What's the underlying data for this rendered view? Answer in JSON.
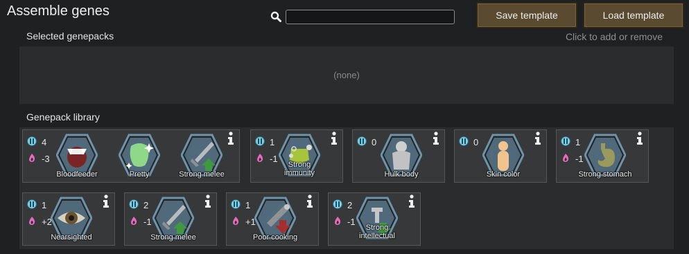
{
  "header": {
    "title": "Assemble genes",
    "search": {
      "value": "",
      "placeholder": ""
    },
    "save_label": "Save template",
    "load_label": "Load template"
  },
  "selected": {
    "label": "Selected genepacks",
    "hint": "Click to add or remove",
    "empty_text": "(none)"
  },
  "library": {
    "label": "Genepack library",
    "packs": [
      {
        "complexity": "4",
        "metabolism": "-3",
        "genes": [
          {
            "name": "Bloodfeeder",
            "icon": "fangs-icon"
          },
          {
            "name": "Pretty",
            "icon": "sparkle-face-icon"
          },
          {
            "name": "Strong melee",
            "icon": "sword-up-icon"
          }
        ]
      },
      {
        "complexity": "1",
        "metabolism": "-1",
        "genes": [
          {
            "name": "Strong immunity",
            "icon": "immunity-icon"
          }
        ]
      },
      {
        "complexity": "0",
        "metabolism": "",
        "genes": [
          {
            "name": "Hulk body",
            "icon": "body-icon"
          }
        ]
      },
      {
        "complexity": "0",
        "metabolism": "",
        "genes": [
          {
            "name": "Skin color",
            "icon": "skin-icon"
          }
        ]
      },
      {
        "complexity": "1",
        "metabolism": "-1",
        "genes": [
          {
            "name": "Strong stomach",
            "icon": "stomach-icon"
          }
        ]
      },
      {
        "complexity": "1",
        "metabolism": "+2",
        "genes": [
          {
            "name": "Nearsighted",
            "icon": "eye-icon"
          }
        ]
      },
      {
        "complexity": "2",
        "metabolism": "-1",
        "genes": [
          {
            "name": "Strong melee",
            "icon": "sword-up-icon"
          }
        ]
      },
      {
        "complexity": "1",
        "metabolism": "+1",
        "genes": [
          {
            "name": "Poor cooking",
            "icon": "cooking-down-icon"
          }
        ]
      },
      {
        "complexity": "2",
        "metabolism": "-1",
        "genes": [
          {
            "name": "Strong intellectual",
            "icon": "intellect-icon"
          }
        ]
      }
    ]
  },
  "colors": {
    "button": "#5a4a2f",
    "complexity": "#6fc7e0",
    "metabolism": "#e05ab0",
    "hex": "#5e7f95"
  }
}
